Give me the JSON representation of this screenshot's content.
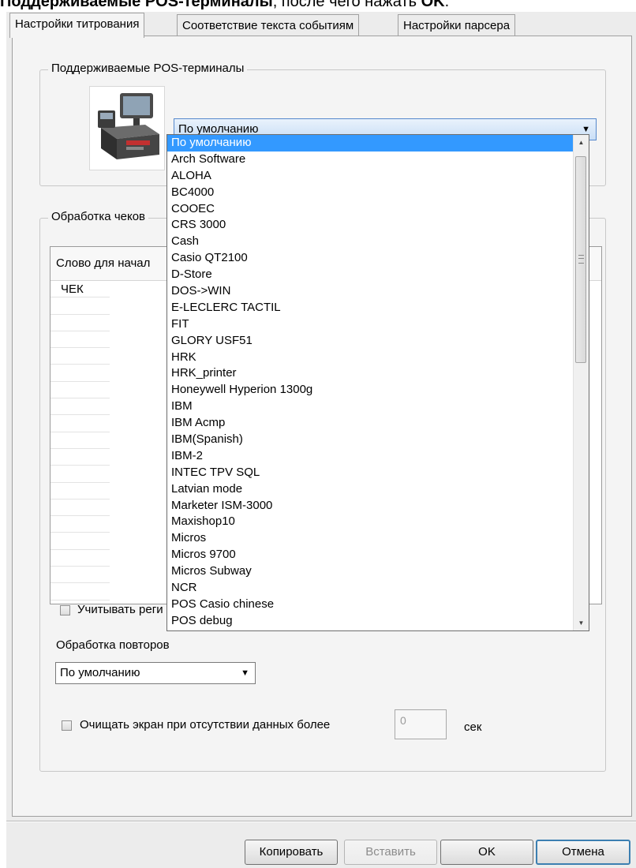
{
  "caption": {
    "bold1": "Поддерживаемые POS-терминалы",
    "rest": ", после чего нажать ",
    "bold2": "OK",
    "end": "."
  },
  "tabs": [
    {
      "label": "Настройки титрования",
      "active": true
    },
    {
      "label": "Соответствие текста событиям",
      "active": false
    },
    {
      "label": "Настройки парсера",
      "active": false
    }
  ],
  "pos_group": {
    "title": "Поддерживаемые POS-терминалы",
    "combo_value": "По умолчанию"
  },
  "dropdown": {
    "items": [
      "По умолчанию",
      " Arch Software",
      "ALOHA",
      "BC4000",
      "COOEC",
      "CRS 3000",
      "Cash",
      "Casio QT2100",
      "D-Store",
      "DOS->WIN",
      "E-LECLERC TACTIL",
      "FIT",
      "GLORY USF51",
      "HRK",
      "HRK_printer",
      "Honeywell Hyperion 1300g",
      "IBM",
      "IBM Acmp",
      "IBM(Spanish)",
      "IBM-2",
      "INTEC TPV SQL",
      "Latvian mode",
      "Marketer ISM-3000",
      "Maxishop10",
      "Micros",
      "Micros 9700",
      "Micros Subway",
      "NCR",
      "POS Casio chinese",
      "POS debug"
    ]
  },
  "checks_group": {
    "title": "Обработка чеков",
    "table_header": "Слово для начал",
    "rows": [
      "ЧЕК",
      "",
      "",
      "",
      "",
      "",
      "",
      "",
      "",
      "",
      "",
      "",
      "",
      "",
      "",
      "",
      "",
      "",
      ""
    ],
    "case_checkbox_label": "Учитывать реги",
    "repeats_label": "Обработка повторов",
    "repeats_value": "По умолчанию",
    "clear_checkbox_label": "Очищать экран при отсутствии данных более",
    "clear_value": "0",
    "clear_unit": "сек"
  },
  "buttons": {
    "copy": "Копировать",
    "paste": "Вставить",
    "ok": "OK",
    "cancel": "Отмена"
  }
}
